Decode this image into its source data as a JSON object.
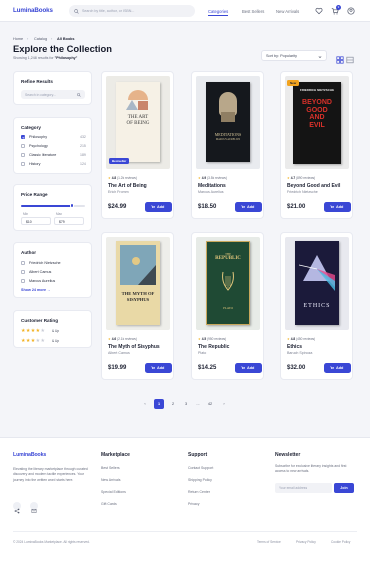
{
  "header": {
    "logo": "LuminaBooks",
    "search_placeholder": "Search by title, author, or ISBN...",
    "nav": [
      "Categories",
      "Best Sellers",
      "New Arrivals"
    ],
    "cart_count": "3"
  },
  "breadcrumb": [
    "Home",
    "Catalog",
    "All Books"
  ],
  "page": {
    "title": "Explore the Collection",
    "subtitle_prefix": "Showing 1,248 results for ",
    "subtitle_query": "\"Philosophy\"",
    "sort_label": "Sort by: Popularity"
  },
  "filters": {
    "refine": {
      "title": "Refine Results",
      "search_placeholder": "Search in category..."
    },
    "category": {
      "title": "Category",
      "items": [
        {
          "label": "Philosophy",
          "count": "432",
          "checked": true
        },
        {
          "label": "Psychology",
          "count": "215",
          "checked": false
        },
        {
          "label": "Classic literature",
          "count": "189",
          "checked": false
        },
        {
          "label": "History",
          "count": "124",
          "checked": false
        }
      ]
    },
    "price": {
      "title": "Price Range",
      "min_label": "Min",
      "max_label": "Max",
      "min": "$10",
      "max": "$79",
      "slider_fraction": 0.8
    },
    "author": {
      "title": "Author",
      "items": [
        "Friedrich Nietzsche",
        "Albert Camus",
        "Marcus Aurelius"
      ],
      "show_all": "Show 24 more →"
    },
    "rating": {
      "title": "Customer Rating",
      "rows": [
        {
          "stars": 4,
          "label": "& Up"
        },
        {
          "stars": 3,
          "label": "& Up"
        }
      ]
    }
  },
  "products": [
    {
      "title": "The Art of Being",
      "author": "Erich Fromm",
      "price": "$24.99",
      "rating": "4.8",
      "reviews": "(1.2k reviews)",
      "tag": "Bestseller",
      "tag_color": "#3a47d5",
      "add": "Add",
      "cover_text": [
        "THE ART",
        "OF BEING"
      ]
    },
    {
      "title": "Meditations",
      "author": "Marcus Aurelius",
      "price": "$18.50",
      "rating": "4.9",
      "reviews": "(3.5k reviews)",
      "tag": "",
      "tag_color": "",
      "add": "Add",
      "cover_text": [
        "MEDITATIONS",
        "MARCUS AURELIUS"
      ]
    },
    {
      "title": "Beyond Good and Evil",
      "author": "Friedrich Nietzsche",
      "price": "$21.00",
      "rating": "4.7",
      "reviews": "(890 reviews)",
      "tag": "New",
      "tag_color": "#f2a31e",
      "add": "Add",
      "cover_text": [
        "FRIEDRICH",
        "NIETZSCHE",
        "BEYOND",
        "GOOD",
        "AND",
        "EVIL"
      ]
    },
    {
      "title": "The Myth of Sisyphus",
      "author": "Albert Camus",
      "price": "$19.99",
      "rating": "4.6",
      "reviews": "(2.1k reviews)",
      "tag": "",
      "tag_color": "",
      "add": "Add",
      "cover_text": [
        "THE MYTH OF",
        "SISYPHUS"
      ]
    },
    {
      "title": "The Republic",
      "author": "Plato",
      "price": "$14.25",
      "rating": "4.5",
      "reviews": "(950 reviews)",
      "tag": "",
      "tag_color": "",
      "add": "Add",
      "cover_text": [
        "THE",
        "REPUBLIC",
        "PLATO"
      ]
    },
    {
      "title": "Ethics",
      "author": "Baruch Spinoza",
      "price": "$32.00",
      "rating": "4.8",
      "reviews": "(450 reviews)",
      "tag": "",
      "tag_color": "",
      "add": "Add",
      "cover_text": [
        "ETHICS"
      ]
    }
  ],
  "pagination": {
    "prev": "‹",
    "pages": [
      "1",
      "2",
      "3",
      "...",
      "42"
    ],
    "next": "›",
    "current": "1"
  },
  "footer": {
    "logo": "LuminaBooks",
    "about": "Elevating the literary marketplace through curated discovery and modern tactile experiences. Your journey into the written word starts here.",
    "marketplace": {
      "title": "Marketplace",
      "links": [
        "Best Sellers",
        "New Arrivals",
        "Special Editions",
        "Gift Cards"
      ]
    },
    "support": {
      "title": "Support",
      "links": [
        "Contact Support",
        "Shipping Policy",
        "Return Center",
        "Privacy"
      ]
    },
    "newsletter": {
      "title": "Newsletter",
      "text": "Subscribe for exclusive literary insights and first access to new arrivals.",
      "placeholder": "Your email address",
      "button": "Join"
    },
    "copyright": "© 2024 LuminaBooks Marketplace. All rights reserved.",
    "legal": [
      "Terms of Service",
      "Privacy Policy",
      "Cookie Policy"
    ]
  },
  "colors": {
    "accent": "#3a47d5",
    "star": "#f2b01e",
    "new_tag": "#f2a31e"
  }
}
